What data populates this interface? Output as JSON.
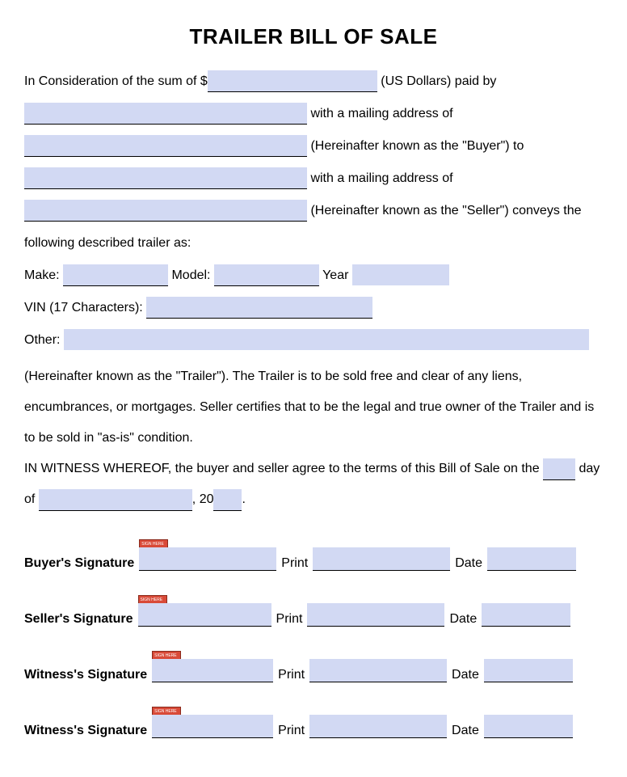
{
  "title": "TRAILER BILL OF SALE",
  "intro": {
    "l1a": "In Consideration of the sum of $",
    "l1b": " (US Dollars) paid by",
    "l2b": " with a mailing address of",
    "l3b": " (Hereinafter known as the \"Buyer\") to",
    "l4b": " with a mailing address of",
    "l5b": " (Hereinafter known as the \"Seller\") conveys the",
    "l6": "following described trailer as:"
  },
  "vehicle": {
    "make_label": "Make: ",
    "model_label": " Model: ",
    "year_label": " Year ",
    "vin_label": "VIN (17 Characters): ",
    "other_label": "Other: "
  },
  "clause": "(Hereinafter known as the \"Trailer\"). The Trailer is to be sold free and clear of any liens, encumbrances, or mortgages. Seller certifies that to be the legal and true owner of the Trailer and is to be sold in \"as-is\" condition.",
  "witness": {
    "a": "IN WITNESS WHEREOF, the buyer and seller agree to the terms of this Bill of Sale on the ",
    "b": " day of ",
    "c": ", 20",
    "d": "."
  },
  "sig": {
    "tag": "SIGN HERE",
    "print": "Print",
    "date": "Date",
    "rows": [
      {
        "label": "Buyer's Signature"
      },
      {
        "label": "Seller's Signature"
      },
      {
        "label": "Witness's Signature"
      },
      {
        "label": "Witness's Signature"
      }
    ]
  }
}
